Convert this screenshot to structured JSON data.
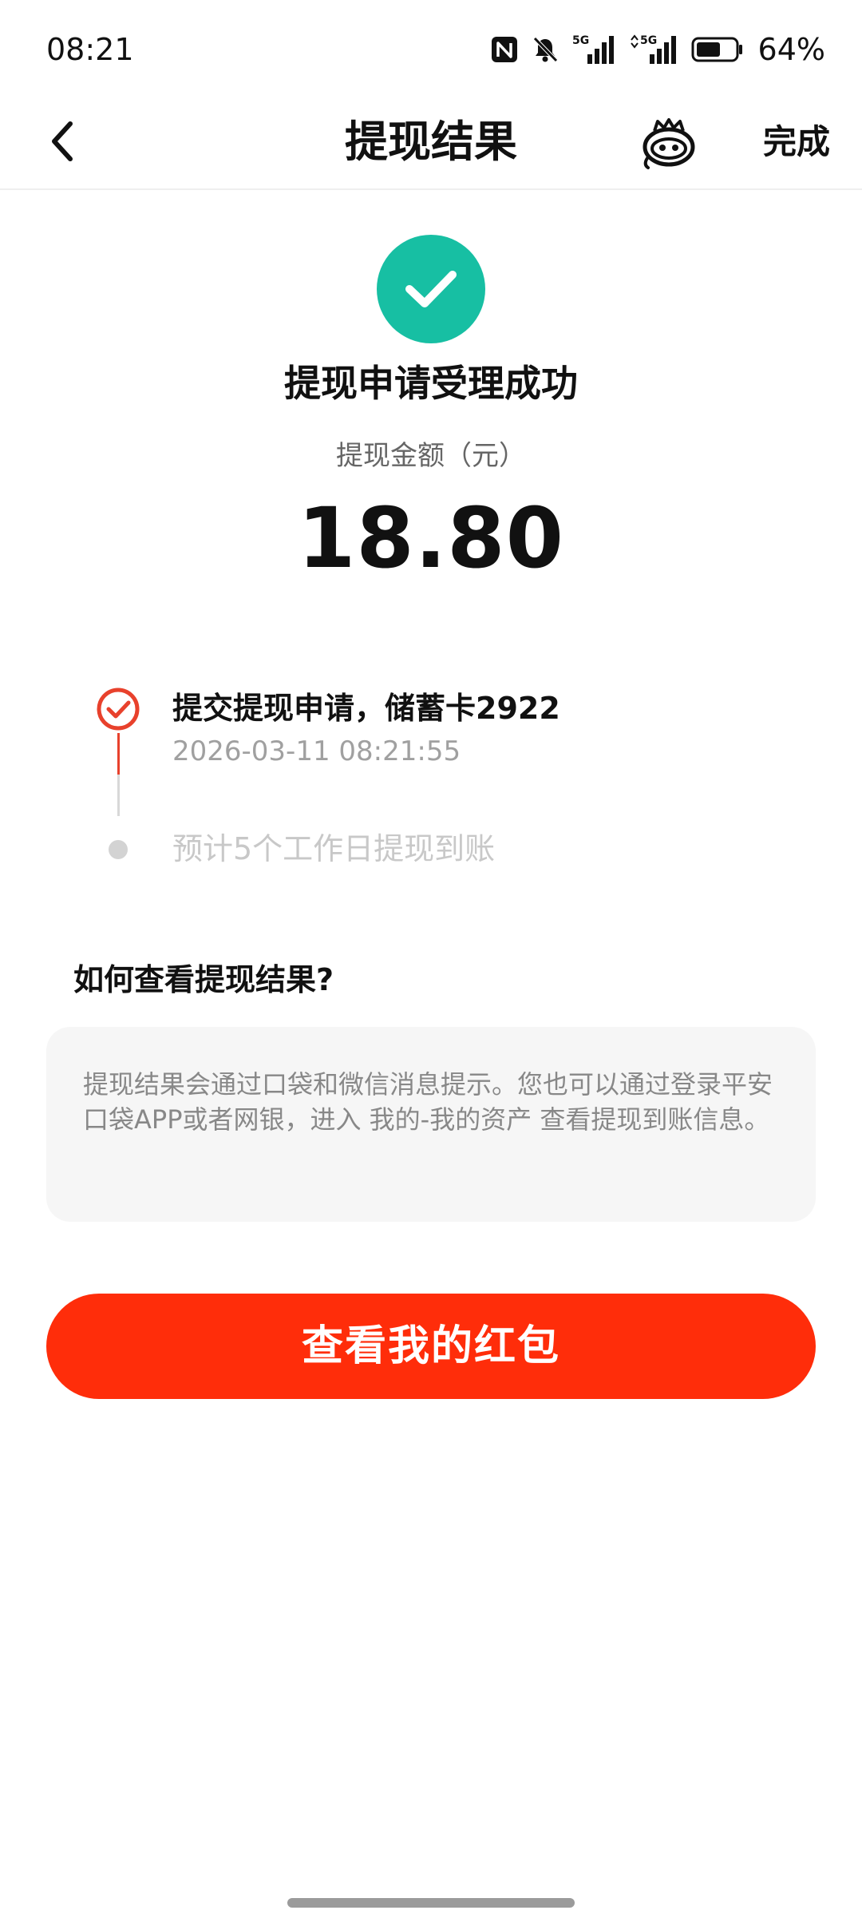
{
  "status_bar": {
    "time": "08:21",
    "network_1": "5G",
    "network_2": "5G",
    "battery_percent": "64%",
    "battery_level": 0.64,
    "icons": [
      "nfc-icon",
      "bell-muted-icon",
      "signal-5g-icon",
      "signal-5g-icon",
      "battery-icon"
    ]
  },
  "nav": {
    "back_icon": "chevron-left-icon",
    "title": "提现结果",
    "assistant_icon": "assistant-mascot-icon",
    "done_label": "完成"
  },
  "result": {
    "status_icon": "check-circle-icon",
    "status_color": "#17bfa3",
    "title": "提现申请受理成功",
    "amount_label": "提现金额（元）",
    "amount": "18.80"
  },
  "timeline": {
    "steps": [
      {
        "title": "提交提现申请，储蓄卡2922",
        "time": "2026-03-11 08:21:55",
        "state": "done",
        "color": "#e8412c"
      },
      {
        "title": "预计5个工作日提现到账",
        "state": "pending",
        "color": "#c8c8c8"
      }
    ]
  },
  "help": {
    "heading": "如何查看提现结果?",
    "body": "提现结果会通过口袋和微信消息提示。您也可以通过登录平安口袋APP或者网银，进入 我的-我的资产 查看提现到账信息。"
  },
  "primary_action": {
    "label": "查看我的红包",
    "color": "#ff2d0a"
  }
}
